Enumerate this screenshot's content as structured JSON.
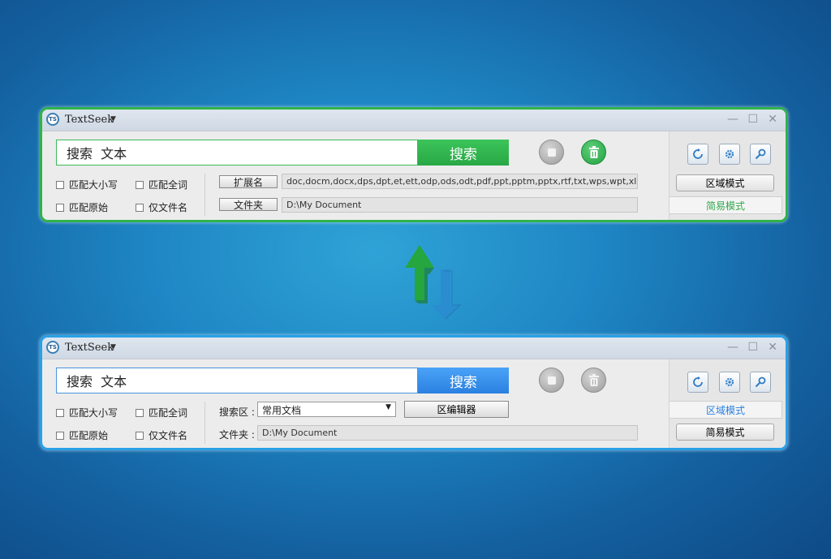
{
  "app": {
    "name": "TextSeek",
    "logo_text": "TS"
  },
  "colors": {
    "green_accent": "#2fb34a",
    "blue_accent": "#2aa0e6",
    "green_button": "#2fb84d",
    "blue_button": "#3a90ee"
  },
  "window_simple": {
    "search_text": "搜索  文本",
    "search_button": "搜索",
    "checkboxes": [
      "匹配大小写",
      "匹配全词",
      "匹配原始",
      "仅文件名"
    ],
    "ext_button": "扩展名",
    "ext_value": "doc,docm,docx,dps,dpt,et,ett,odp,ods,odt,pdf,ppt,pptm,pptx,rtf,txt,wps,wpt,xls,xlsm,xlsx",
    "folder_button": "文件夹",
    "folder_value": "D:\\My Document",
    "mode_zone": "区域模式",
    "mode_simple": "简易模式"
  },
  "window_zone": {
    "search_text": "搜索  文本",
    "search_button": "搜索",
    "checkboxes": [
      "匹配大小写",
      "匹配全词",
      "匹配原始",
      "仅文件名"
    ],
    "zone_label": "搜索区 :",
    "zone_value": "常用文档",
    "zone_editor": "区编辑器",
    "folder_label": "文件夹 :",
    "folder_value": "D:\\My Document",
    "mode_zone": "区域模式",
    "mode_simple": "简易模式"
  },
  "icons": [
    "refresh-icon",
    "settings-icon",
    "search-tool-icon",
    "stop-icon",
    "trash-icon",
    "swap-arrows-icon"
  ]
}
